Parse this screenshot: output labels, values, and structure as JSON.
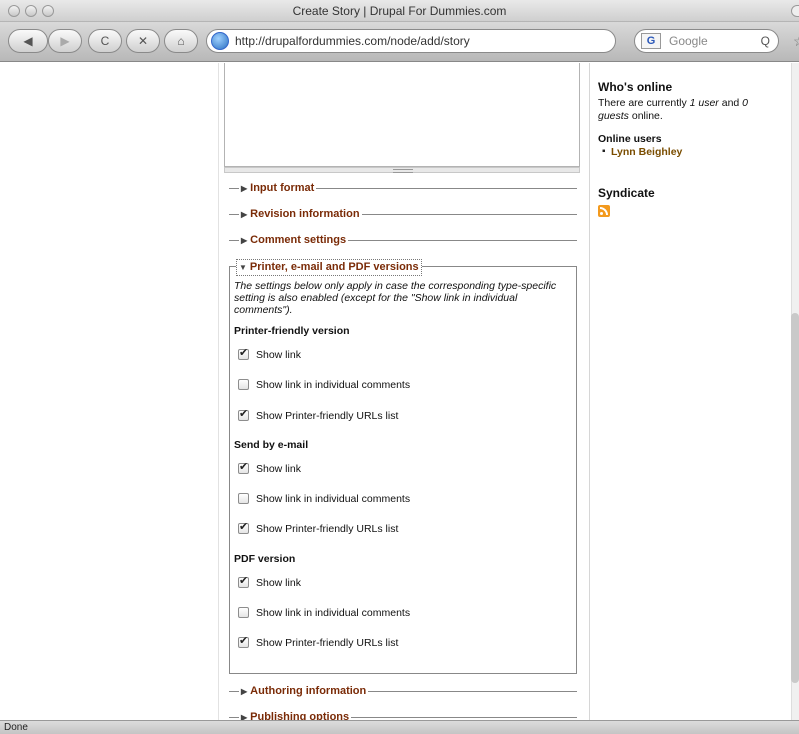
{
  "window": {
    "title": "Create Story | Drupal For Dummies.com"
  },
  "toolbar": {
    "back_glyph": "◀",
    "forward_glyph": "▶",
    "reload_glyph": "C",
    "stop_glyph": "✕",
    "home_glyph": "⌂",
    "url": "http://drupalfordummies.com/node/add/story",
    "bookmark_glyph": "☆▾",
    "search_engine_glyph": "G",
    "search_placeholder": "Google",
    "search_glyph": "Q"
  },
  "form": {
    "collapsed_fieldsets_top": [
      {
        "label": "Input format"
      },
      {
        "label": "Revision information"
      },
      {
        "label": "Comment settings"
      }
    ],
    "expanded_fieldset": {
      "label": "Printer, e-mail and PDF versions",
      "description": "The settings below only apply in case the corresponding type-specific setting is also enabled (except for the \"Show link in individual comments\").",
      "groups": [
        {
          "title": "Printer-friendly version",
          "options": [
            {
              "label": "Show link",
              "checked": true
            },
            {
              "label": "Show link in individual comments",
              "checked": false
            },
            {
              "label": "Show Printer-friendly URLs list",
              "checked": true
            }
          ]
        },
        {
          "title": "Send by e-mail",
          "options": [
            {
              "label": "Show link",
              "checked": true
            },
            {
              "label": "Show link in individual comments",
              "checked": false
            },
            {
              "label": "Show Printer-friendly URLs list",
              "checked": true
            }
          ]
        },
        {
          "title": "PDF version",
          "options": [
            {
              "label": "Show link",
              "checked": true
            },
            {
              "label": "Show link in individual comments",
              "checked": false
            },
            {
              "label": "Show Printer-friendly URLs list",
              "checked": true
            }
          ]
        }
      ]
    },
    "collapsed_fieldsets_bottom": [
      {
        "label": "Authoring information"
      },
      {
        "label": "Publishing options"
      }
    ]
  },
  "sidebar": {
    "whos_online": {
      "title": "Who's online",
      "text_1": "There are currently ",
      "users": "1 user",
      "text_2": " and ",
      "guests": "0 guests",
      "text_3": " online."
    },
    "online_users": {
      "title": "Online users",
      "users": [
        "Lynn Beighley"
      ]
    },
    "syndicate": {
      "title": "Syndicate",
      "icon": "rss-icon"
    }
  },
  "status": {
    "text": "Done"
  }
}
